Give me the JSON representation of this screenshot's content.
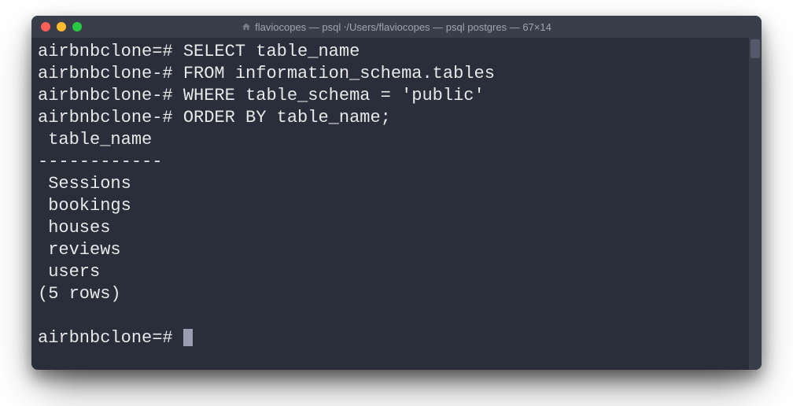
{
  "titlebar": {
    "title": "flaviocopes — psql ⸱/Users/flaviocopes — psql postgres — 67×14"
  },
  "terminal": {
    "lines": [
      "airbnbclone=# SELECT table_name",
      "airbnbclone-# FROM information_schema.tables",
      "airbnbclone-# WHERE table_schema = 'public'",
      "airbnbclone-# ORDER BY table_name;",
      " table_name",
      "------------",
      " Sessions",
      " bookings",
      " houses",
      " reviews",
      " users",
      "(5 rows)",
      "",
      "airbnbclone=# "
    ]
  }
}
